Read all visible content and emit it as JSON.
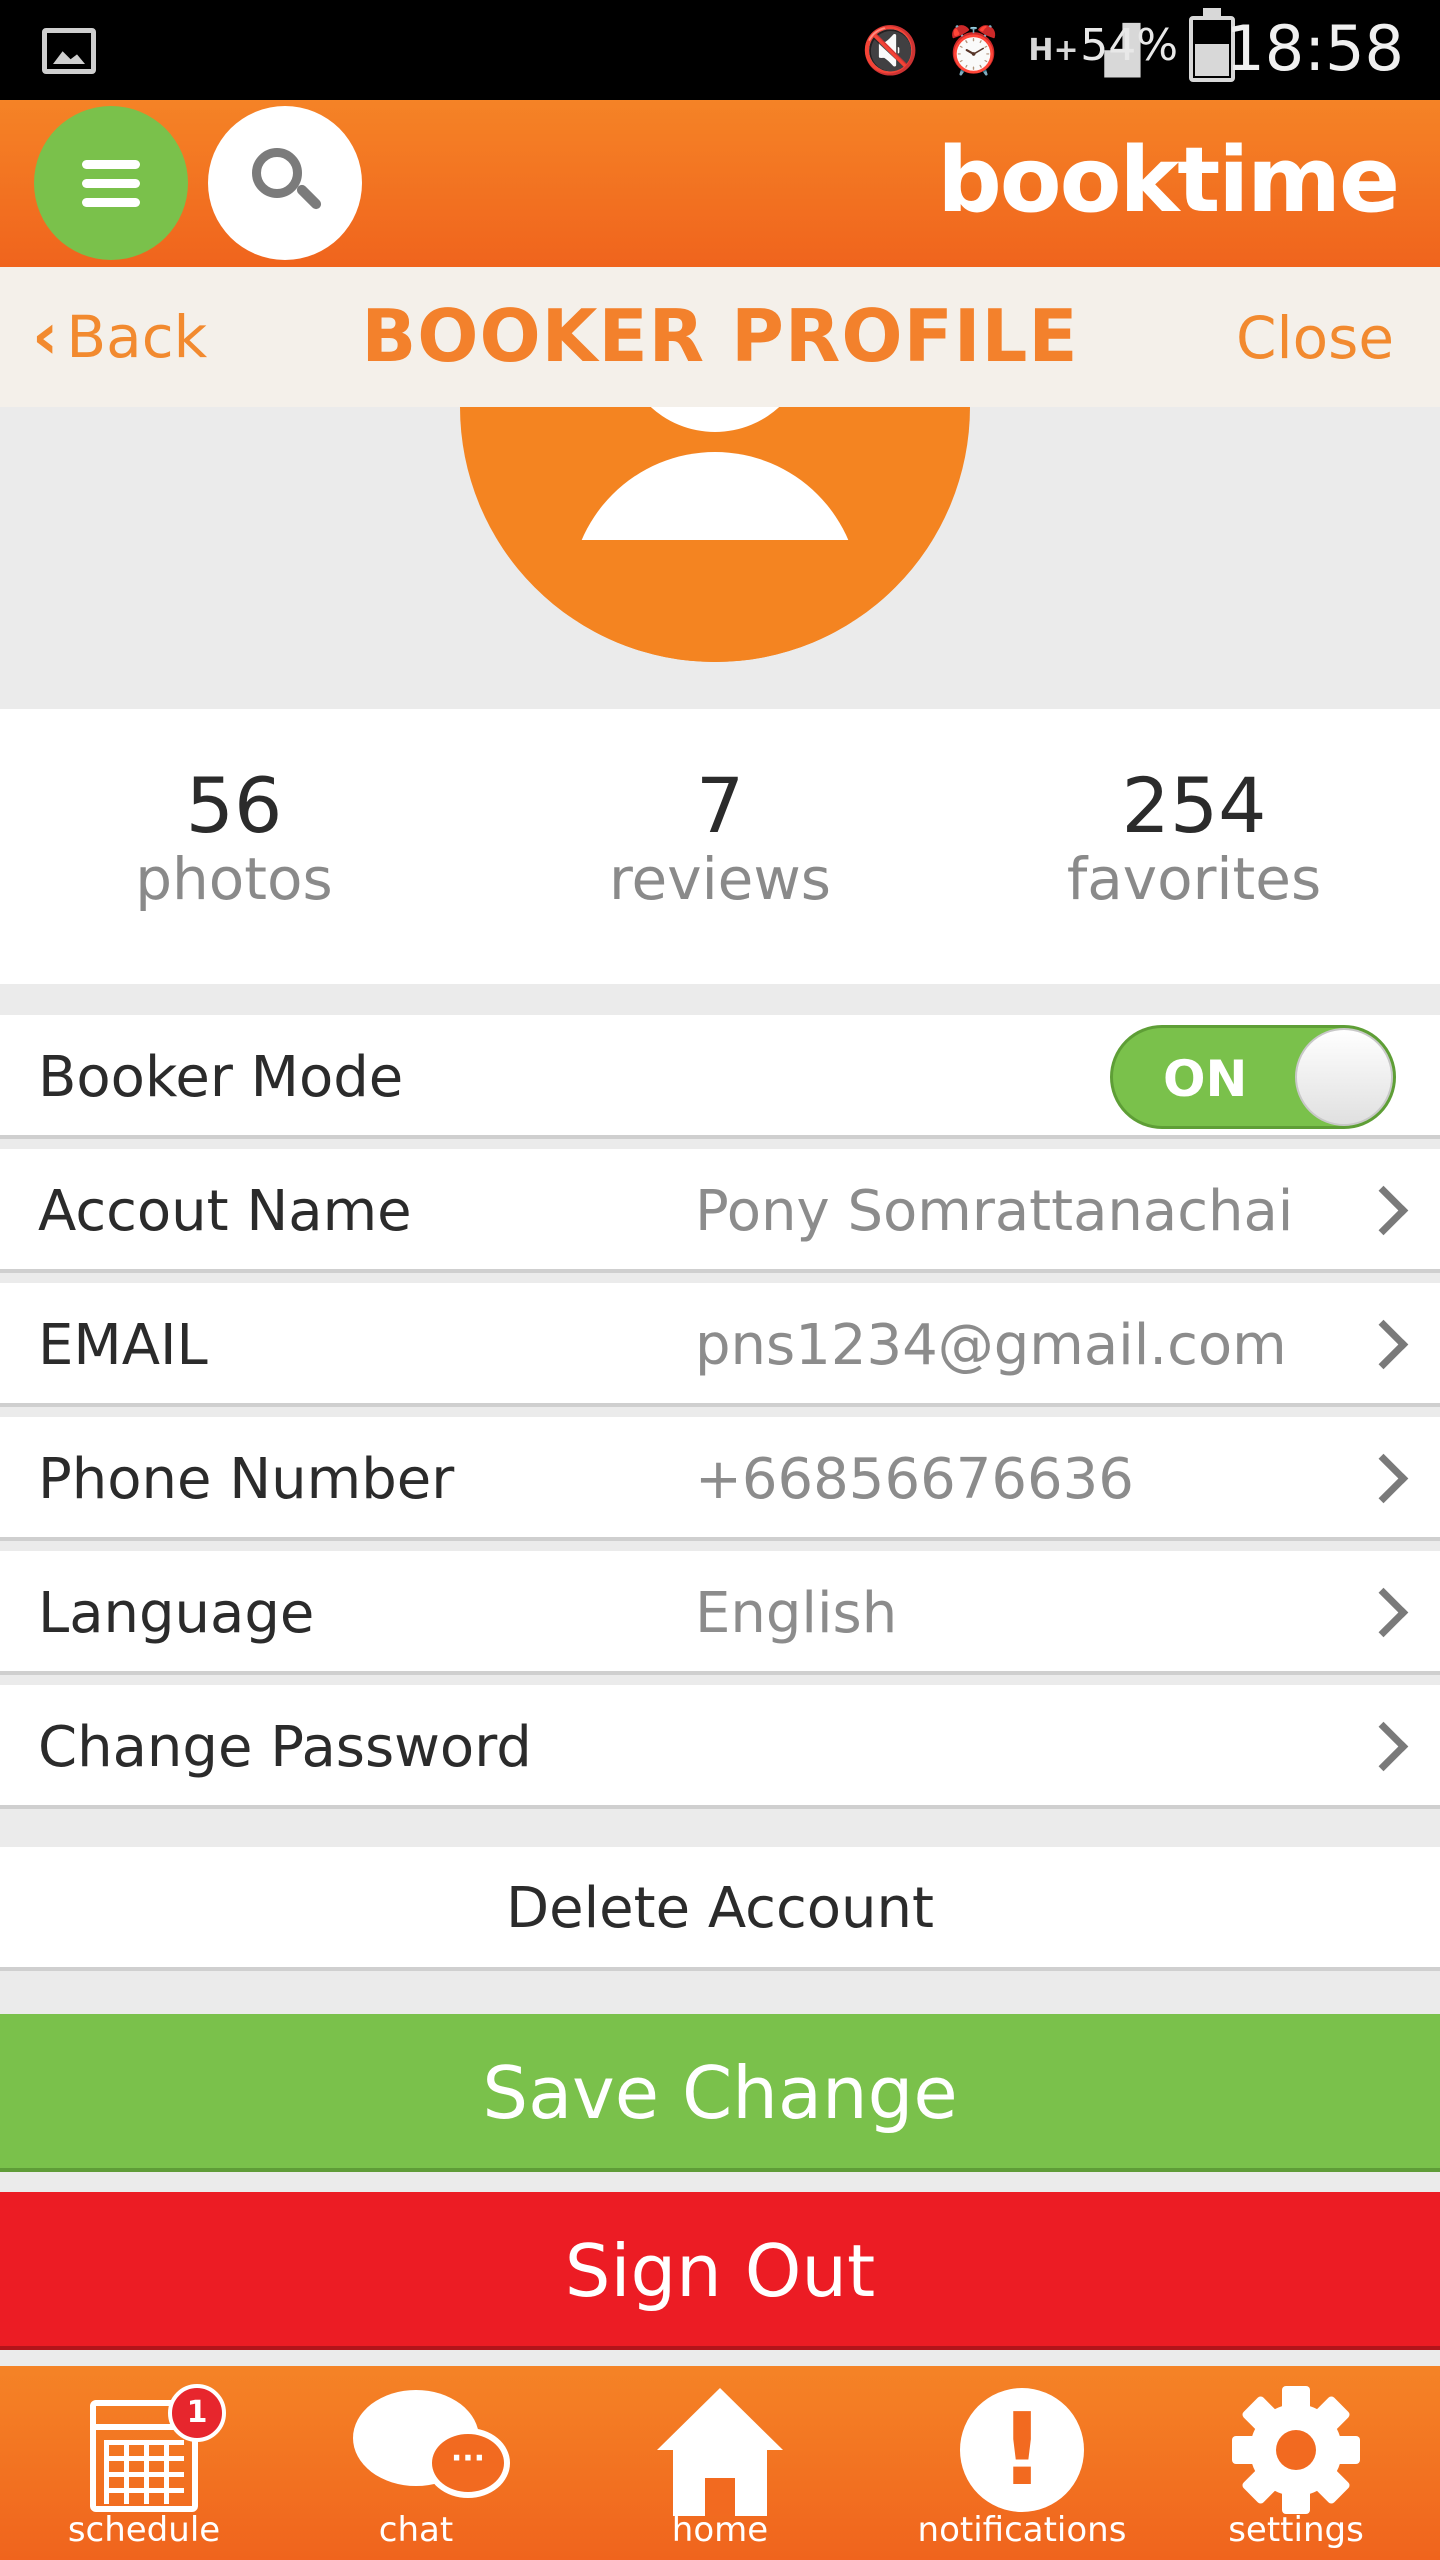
{
  "status_bar": {
    "icons": [
      "gallery-icon",
      "mute-icon",
      "alarm-icon",
      "network-type-icon",
      "signal-icon",
      "battery-icon"
    ],
    "network_type": "H+",
    "battery_percent": "54%",
    "time": "18:58"
  },
  "header": {
    "brand": "booktime",
    "menu_icon": "hamburger-menu-icon",
    "search_icon": "search-icon",
    "accent_color": "#F47A22",
    "menu_color": "#7AC14B"
  },
  "titlebar": {
    "back_label": "Back",
    "title": "BOOKER PROFILE",
    "close_label": "Close"
  },
  "stats": [
    {
      "value": "56",
      "label": "photos"
    },
    {
      "value": "7",
      "label": "reviews"
    },
    {
      "value": "254",
      "label": "favorites"
    }
  ],
  "settings": {
    "booker_mode": {
      "label": "Booker Mode",
      "toggle_text": "ON",
      "enabled": true
    },
    "rows": [
      {
        "label": "Accout Name",
        "value": "Pony Somrattanachai"
      },
      {
        "label": "EMAIL",
        "value": "pns1234@gmail.com"
      },
      {
        "label": "Phone Number",
        "value": "+66856676636"
      },
      {
        "label": "Language",
        "value": "English"
      },
      {
        "label": "Change Password",
        "value": ""
      }
    ],
    "delete_account": "Delete Account"
  },
  "actions": {
    "save": "Save Change",
    "save_color": "#7AC14B",
    "sign_out": "Sign Out",
    "sign_out_color": "#EC1C24"
  },
  "bottom_nav": {
    "items": [
      {
        "label": "schedule",
        "icon": "calendar-icon",
        "badge": "1"
      },
      {
        "label": "chat",
        "icon": "chat-icon"
      },
      {
        "label": "home",
        "icon": "home-icon"
      },
      {
        "label": "notifications",
        "icon": "alert-icon"
      },
      {
        "label": "settings",
        "icon": "gear-icon"
      }
    ]
  }
}
